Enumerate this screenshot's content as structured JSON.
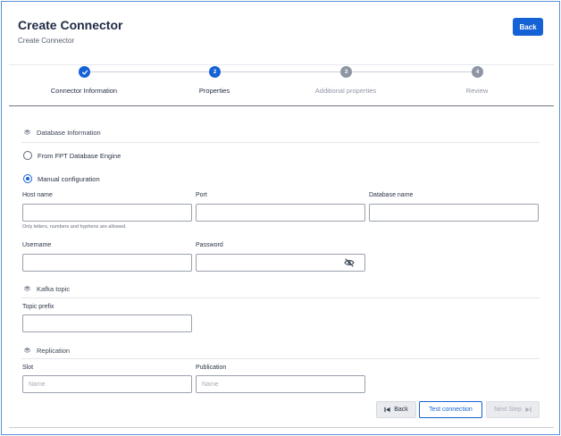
{
  "header": {
    "title": "Create Connector",
    "subtitle": "Create Connector",
    "back_label": "Back"
  },
  "stepper": {
    "steps": [
      {
        "number": "",
        "label": "Connector Information",
        "state": "done"
      },
      {
        "number": "2",
        "label": "Properties",
        "state": "active"
      },
      {
        "number": "3",
        "label": "Additional properties",
        "state": "pending"
      },
      {
        "number": "4",
        "label": "Review",
        "state": "pending"
      }
    ]
  },
  "database": {
    "section_title": "Database Information",
    "option_engine": "From FPT Database Engine",
    "option_manual": "Manual configuration",
    "selected": "manual",
    "host_label": "Host name",
    "host_value": "",
    "host_hint": "Only letters, numbers and hyphens are allowed.",
    "port_label": "Port",
    "port_value": "",
    "dbname_label": "Database name",
    "dbname_value": "",
    "username_label": "Username",
    "username_value": "",
    "password_label": "Password",
    "password_value": ""
  },
  "kafka": {
    "section_title": "Kafka topic",
    "prefix_label": "Topic prefix",
    "prefix_value": ""
  },
  "replication": {
    "section_title": "Replication",
    "slot_label": "Slot",
    "slot_placeholder": "Name",
    "publication_label": "Publication",
    "publication_placeholder": "Name"
  },
  "footer": {
    "back_label": "Back",
    "test_label": "Test connection",
    "next_label": "Next Step"
  },
  "colors": {
    "primary": "#1561d6",
    "pending": "#8e95a3",
    "disabled": "#a7adb7"
  },
  "icons": {
    "step_done": "check-icon",
    "section": "layers-icon",
    "password_toggle": "eye-off-icon",
    "back": "skip-back-icon",
    "next": "skip-forward-icon"
  }
}
